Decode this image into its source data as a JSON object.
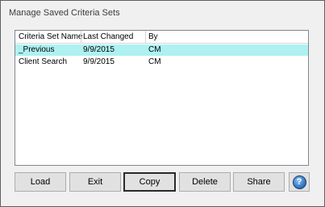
{
  "window": {
    "title": "Manage Saved Criteria Sets"
  },
  "table": {
    "columns": [
      "Criteria Set Name",
      "Last Changed",
      "By"
    ],
    "rows": [
      {
        "name": "_Previous",
        "last_changed": "9/9/2015",
        "by": "CM",
        "selected": true
      },
      {
        "name": "Client Search",
        "last_changed": "9/9/2015",
        "by": "CM",
        "selected": false
      }
    ]
  },
  "buttons": {
    "load": "Load",
    "exit": "Exit",
    "copy": "Copy",
    "delete": "Delete",
    "share": "Share",
    "help_glyph": "?"
  },
  "icons": {
    "help": "help-icon"
  },
  "colors": {
    "selected_row": "#aef1f1",
    "help_icon": "#3c7fc9"
  }
}
